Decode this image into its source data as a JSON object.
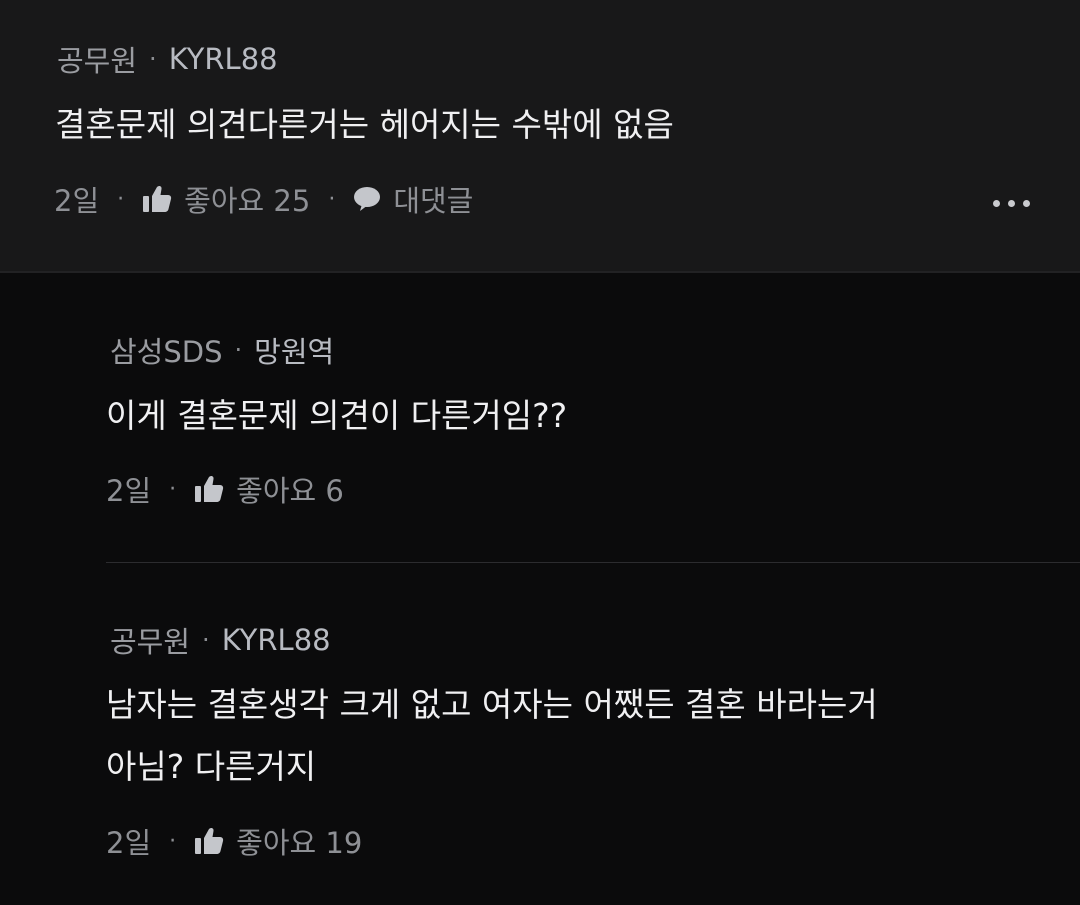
{
  "comments": [
    {
      "job": "공무원",
      "nickname": "KYRL88",
      "text": "결혼문제 의견다른거는 헤어지는 수밖에 없음",
      "time": "2일",
      "like_label": "좋아요 25",
      "reply_label": "대댓글"
    },
    {
      "job": "삼성SDS",
      "nickname": "망원역",
      "text": "이게 결혼문제 의견이 다른거임??",
      "time": "2일",
      "like_label": "좋아요 6"
    },
    {
      "job": "공무원",
      "nickname": "KYRL88",
      "text_line1": "남자는 결혼생각 크게 없고 여자는 어쨌든 결혼 바라는거",
      "text_line2": "아님? 다른거지",
      "time": "2일",
      "like_label": "좋아요 19"
    }
  ],
  "separator": "·",
  "icons": {
    "like": "thumbs-up-icon",
    "reply": "speech-bubble-icon",
    "more": "more-dots-icon"
  },
  "colors": {
    "background": "#0b0b0c",
    "main_comment_bg": "#181819",
    "text": "#f0f0f2",
    "meta": "#9a9ca1"
  }
}
